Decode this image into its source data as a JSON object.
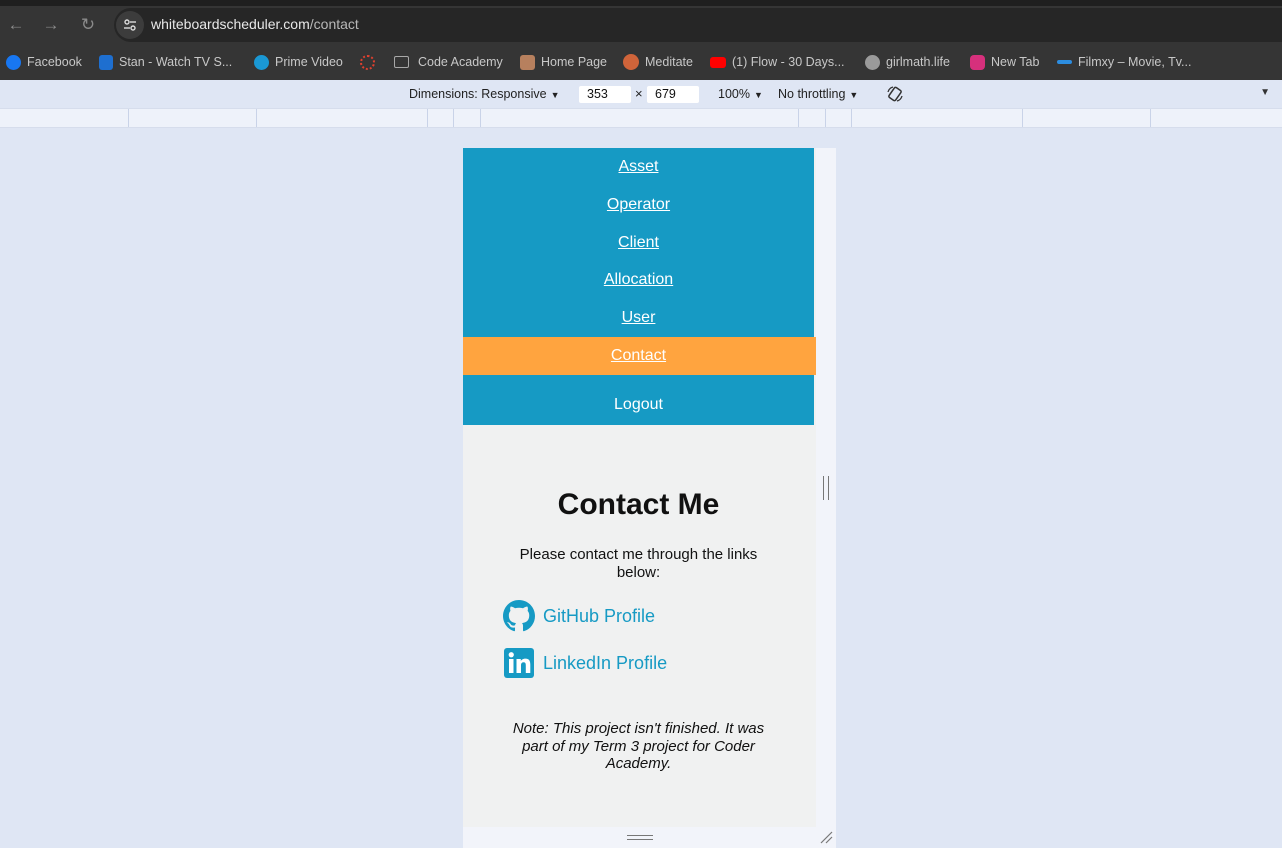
{
  "browser": {
    "back_icon": "←",
    "forward_icon": "→",
    "reload_icon": "↻",
    "url_host": "whiteboardscheduler.com",
    "url_path": "/contact"
  },
  "bookmarks": [
    {
      "label": "Facebook",
      "color": "#1877f2"
    },
    {
      "label": "Stan - Watch TV S...",
      "color": "#1e6fd0"
    },
    {
      "label": "Prime Video",
      "color": "#1a98d4"
    },
    {
      "label": "",
      "color": "#e0402f"
    },
    {
      "label": "Code Academy",
      "color": "#9a9a9a"
    },
    {
      "label": "Home Page",
      "color": "#b7805e"
    },
    {
      "label": "Meditate",
      "color": "#d0643a"
    },
    {
      "label": "(1) Flow - 30 Days...",
      "color": "#ff0000"
    },
    {
      "label": "girlmath.life",
      "color": "#9a9a9a"
    },
    {
      "label": "New Tab",
      "color": "#d6307c"
    },
    {
      "label": "Filmxy – Movie, Tv...",
      "color": "#2c8de0"
    }
  ],
  "devtools": {
    "dimensions_label": "Dimensions: Responsive",
    "width": "353",
    "times": "×",
    "height": "679",
    "zoom": "100%",
    "throttling": "No throttling",
    "dropdown_icon": "▼"
  },
  "page": {
    "nav": {
      "items": [
        "Asset",
        "Operator",
        "Client",
        "Allocation",
        "User"
      ],
      "active": "Contact",
      "logout": "Logout",
      "bg_color": "#169ac4",
      "active_color": "#ffa43f"
    },
    "title": "Contact Me",
    "lead": "Please contact me through the links below:",
    "links": [
      {
        "label": "GitHub Profile",
        "icon": "github-icon"
      },
      {
        "label": "LinkedIn Profile",
        "icon": "linkedin-icon"
      }
    ],
    "note": "Note: This project isn't finished. It was part of my Term 3 project for Coder Academy."
  }
}
